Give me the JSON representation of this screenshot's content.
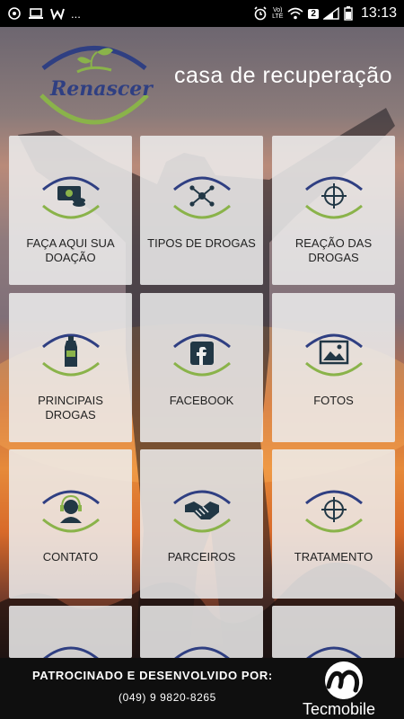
{
  "status_bar": {
    "time": "13:13",
    "network": "LTE",
    "network_top": "Vo)",
    "sim_badge": "2",
    "left_icons": [
      "sync-icon",
      "laptop-icon",
      "w-logo-icon",
      "more-dots-icon"
    ],
    "right_icons": [
      "alarm-icon",
      "volte-icon",
      "wifi-icon",
      "sim-2-badge",
      "signal-icon",
      "battery-icon"
    ],
    "more": "..."
  },
  "header": {
    "logo_text": "Renascer",
    "subtitle": "casa de recuperação"
  },
  "tiles": [
    {
      "label": "FAÇA AQUI SUA DOAÇÃO",
      "icon": "money-icon"
    },
    {
      "label": "TIPOS DE DROGAS",
      "icon": "molecule-icon"
    },
    {
      "label": "REAÇÃO DAS DROGAS",
      "icon": "crosshair-icon"
    },
    {
      "label": "PRINCIPAIS DROGAS",
      "icon": "bottle-icon"
    },
    {
      "label": "FACEBOOK",
      "icon": "facebook-icon"
    },
    {
      "label": "FOTOS",
      "icon": "photo-icon"
    },
    {
      "label": "CONTATO",
      "icon": "headset-icon"
    },
    {
      "label": "PARCEIROS",
      "icon": "handshake-icon"
    },
    {
      "label": "TRATAMENTO",
      "icon": "crosshair-icon"
    }
  ],
  "footer": {
    "sponsor": "PATROCINADO E DESENVOLVIDO POR:",
    "phone": "(049) 9 9820-8265",
    "brand": "Tecmobile"
  },
  "colors": {
    "arc_blue": "#2f3f82",
    "arc_green": "#8ab34a",
    "icon_dark": "#213745",
    "tile_bg": "#eeeeee"
  }
}
